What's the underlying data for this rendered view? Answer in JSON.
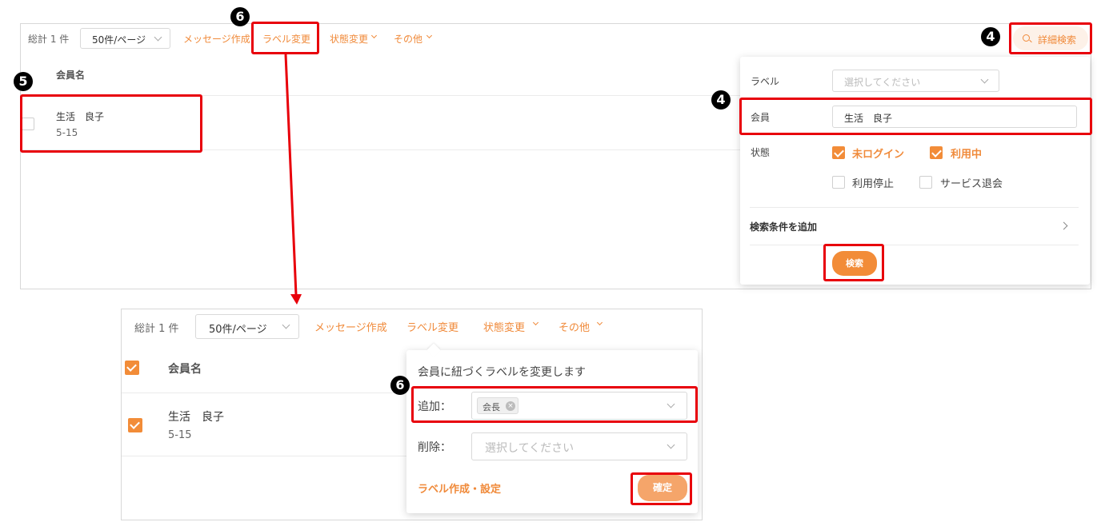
{
  "top": {
    "total_label": "総計 1 件",
    "per_page_value": "50件/ページ",
    "message_create": "メッセージ作成",
    "label_change": "ラベル変更",
    "status_change": "状態変更",
    "other": "その他",
    "detail_search": "詳細検索",
    "column_member_name": "会員名",
    "row_name": "生活　良子",
    "row_id": "5-15"
  },
  "search_panel": {
    "label_field_label": "ラベル",
    "label_placeholder": "選択してください",
    "member_field_label": "会員",
    "member_value": "生活　良子",
    "status_label": "状態",
    "status_options": [
      {
        "label": "未ログイン",
        "checked": true
      },
      {
        "label": "利用中",
        "checked": true
      },
      {
        "label": "利用停止",
        "checked": false
      },
      {
        "label": "サービス退会",
        "checked": false
      }
    ],
    "add_condition": "検索条件を追加",
    "search_button": "検索"
  },
  "bottom": {
    "total_label": "総計 1 件",
    "per_page_value": "50件/ページ",
    "message_create": "メッセージ作成",
    "label_change": "ラベル変更",
    "status_change": "状態変更",
    "other": "その他",
    "column_member_name": "会員名",
    "row_name": "生活　良子",
    "row_id": "5-15"
  },
  "label_popover": {
    "title": "会員に紐づくラベルを変更します",
    "add_label": "追加：",
    "add_tag": "会長",
    "remove_label": "削除：",
    "remove_placeholder": "選択してください",
    "create_link": "ラベル作成・設定",
    "confirm_button": "確定"
  },
  "annotations": {
    "step4": "4",
    "step5": "5",
    "step6": "6"
  },
  "colors": {
    "accent": "#f28c38",
    "highlight": "#e8000b"
  }
}
